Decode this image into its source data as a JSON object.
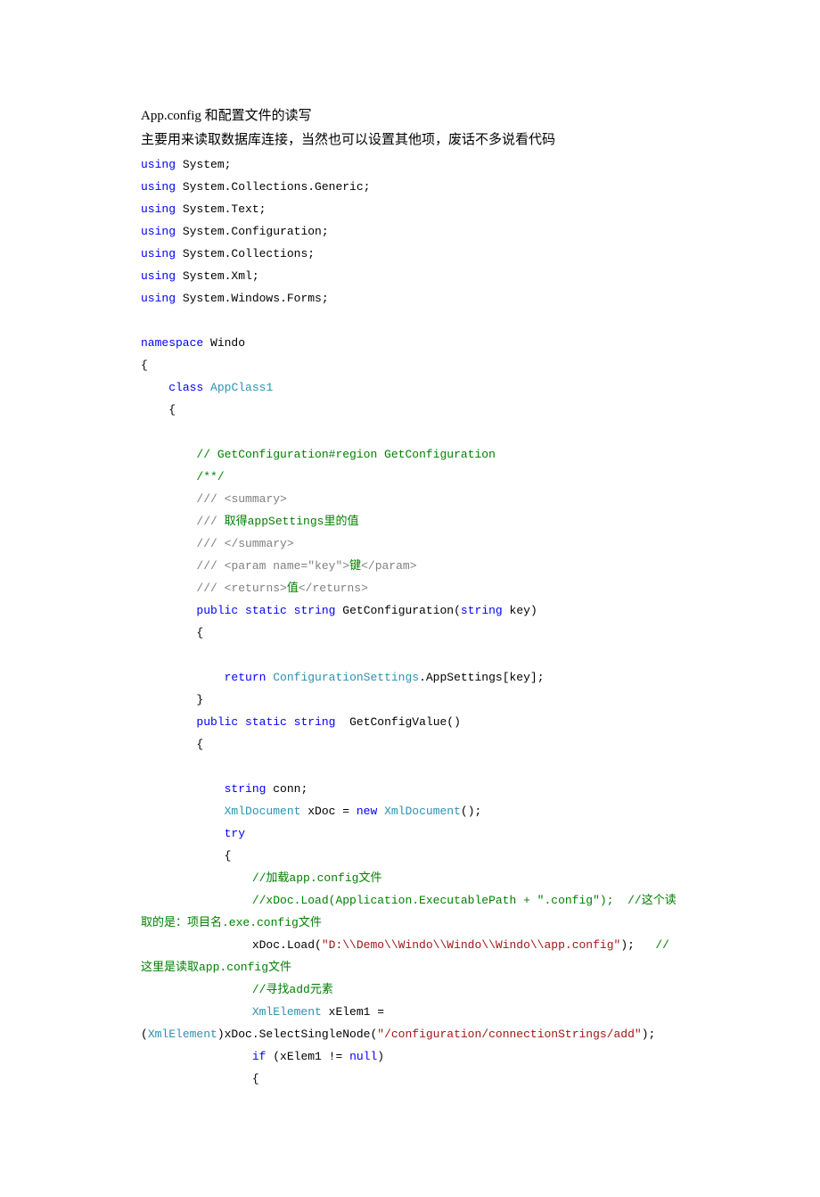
{
  "title": "App.config 和配置文件的读写",
  "desc": "主要用来读取数据库连接，当然也可以设置其他项，废话不多说看代码",
  "code": {
    "l1_kw": "using",
    "l1_txt": " System;",
    "l2_kw": "using",
    "l2_txt": " System.Collections.Generic;",
    "l3_kw": "using",
    "l3_txt": " System.Text;",
    "l4_kw": "using",
    "l4_txt": " System.Configuration;",
    "l5_kw": "using",
    "l5_txt": " System.Collections;",
    "l6_kw": "using",
    "l6_txt": " System.Xml;",
    "l7_kw": "using",
    "l7_txt": " System.Windows.Forms;",
    "l9_kw": "namespace",
    "l9_txt": " Windo",
    "l10": "{",
    "l11_a": "    ",
    "l11_kw": "class",
    "l11_sp": " ",
    "l11_typ": "AppClass1",
    "l12": "    {",
    "l14_a": "        ",
    "l14_com": "// GetConfiguration#region GetConfiguration",
    "l15_a": "        ",
    "l15_com": "/**/",
    "l16_a": "        ",
    "l16_cx": "/// ",
    "l16_cx2": "<summary>",
    "l17_a": "        ",
    "l17_cx": "///",
    "l17_com": " 取得appSettings里的值",
    "l18_a": "        ",
    "l18_cx": "/// ",
    "l18_cx2": "</summary>",
    "l19_a": "        ",
    "l19_cx": "/// ",
    "l19_cx2": "<param name=\"key\">",
    "l19_com": "键",
    "l19_cx3": "</param>",
    "l20_a": "        ",
    "l20_cx": "/// ",
    "l20_cx2": "<returns>",
    "l20_com": "值",
    "l20_cx3": "</returns>",
    "l21_a": "        ",
    "l21_kw1": "public",
    "l21_sp1": " ",
    "l21_kw2": "static",
    "l21_sp2": " ",
    "l21_kw3": "string",
    "l21_txt": " GetConfiguration(",
    "l21_kw4": "string",
    "l21_txt2": " key)",
    "l22": "        {",
    "l24_a": "            ",
    "l24_kw": "return",
    "l24_sp": " ",
    "l24_typ": "ConfigurationSettings",
    "l24_txt": ".AppSettings[key];",
    "l25": "        }",
    "l26_a": "        ",
    "l26_kw1": "public",
    "l26_sp1": " ",
    "l26_kw2": "static",
    "l26_sp2": " ",
    "l26_kw3": "string",
    "l26_txt": "  GetConfigValue()",
    "l27": "        {",
    "l29_a": "            ",
    "l29_kw": "string",
    "l29_txt": " conn;",
    "l30_a": "            ",
    "l30_typ1": "XmlDocument",
    "l30_txt1": " xDoc = ",
    "l30_kw": "new",
    "l30_sp": " ",
    "l30_typ2": "XmlDocument",
    "l30_txt2": "();",
    "l31_a": "            ",
    "l31_kw": "try",
    "l32": "            {",
    "l33_a": "                ",
    "l33_com": "//加载app.config文件",
    "l34_a": "                ",
    "l34_com": "//xDoc.Load(Application.ExecutablePath + \".config\");  //这个读取的是：项目名.exe.config文件",
    "l35_a": "                xDoc.Load(",
    "l35_str": "\"D:\\\\Demo\\\\Windo\\\\Windo\\\\Windo\\\\app.config\"",
    "l35_txt": ");   ",
    "l35_com": "//这里是读取app.config文件",
    "l36_a": "                ",
    "l36_com": "//寻找add元素",
    "l37_a": "                ",
    "l37_typ1": "XmlElement",
    "l37_txt1": " xElem1 = (",
    "l37_typ2": "XmlElement",
    "l37_txt2": ")xDoc.SelectSingleNode(",
    "l37_str": "\"/configuration/connectionStrings/add\"",
    "l37_txt3": ");",
    "l38_a": "                ",
    "l38_kw1": "if",
    "l38_txt": " (xElem1 != ",
    "l38_kw2": "null",
    "l38_txt2": ")",
    "l39": "                {"
  }
}
